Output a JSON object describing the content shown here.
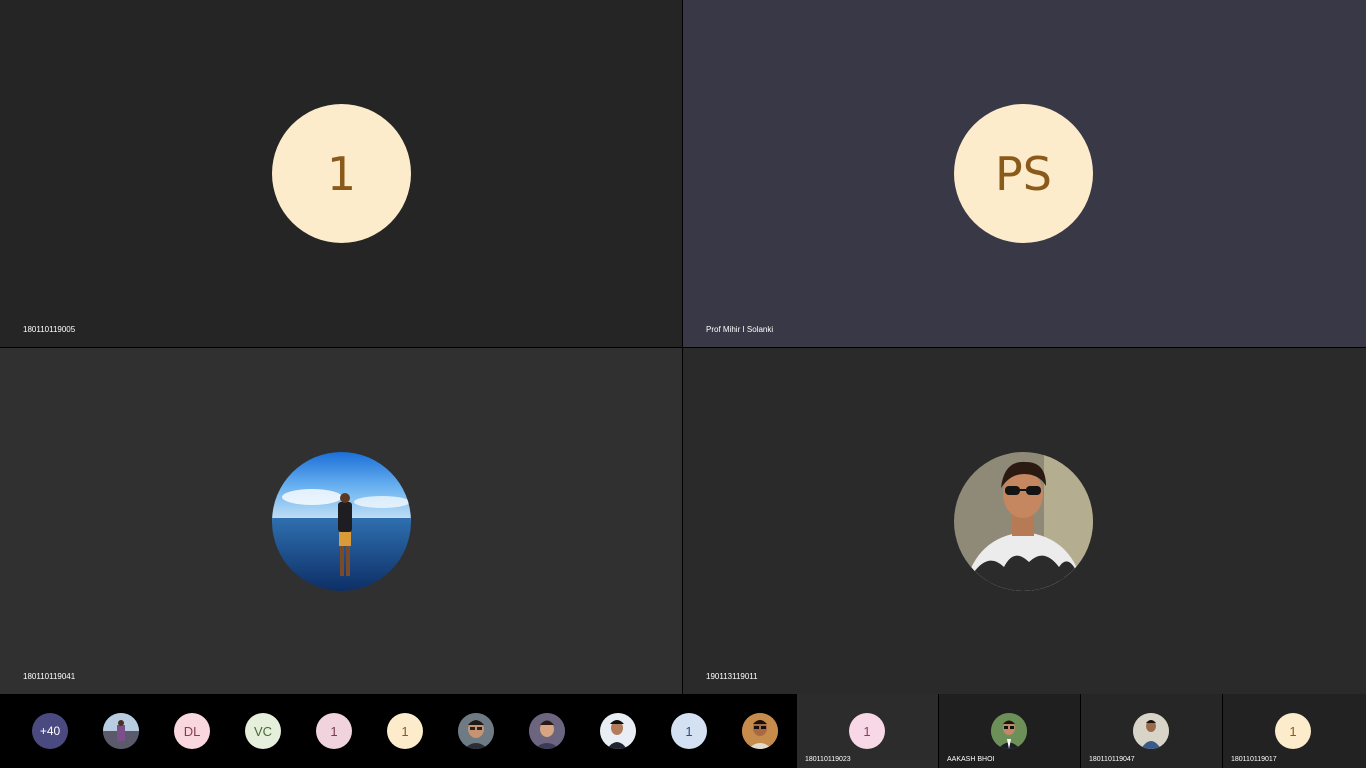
{
  "main_tiles": [
    {
      "name": "180110119005",
      "initials": "1"
    },
    {
      "name": "Prof Mihir I Solanki",
      "initials": "PS"
    },
    {
      "name": "180110119041"
    },
    {
      "name": "190113119011"
    }
  ],
  "strip": {
    "more_count": "+40",
    "avatars": [
      {
        "initials": "DL"
      },
      {
        "initials": "VC"
      },
      {
        "initials": "1"
      },
      {
        "initials": "1"
      },
      {
        "initials": "1"
      }
    ]
  },
  "mini_tiles": [
    {
      "name": "180110119023",
      "initials": "1"
    },
    {
      "name": "AAKASH BHOI"
    },
    {
      "name": "180110119047"
    },
    {
      "name": "180110119017",
      "initials": "1"
    }
  ],
  "colors": {
    "avatar_peach": "#fdeccc",
    "avatar_pink": "#f8d8de",
    "avatar_green": "#e5efdb",
    "avatar_mauve": "#f0d3dc",
    "avatar_blue": "#d3e1f3",
    "more_badge": "#4b4a80"
  }
}
